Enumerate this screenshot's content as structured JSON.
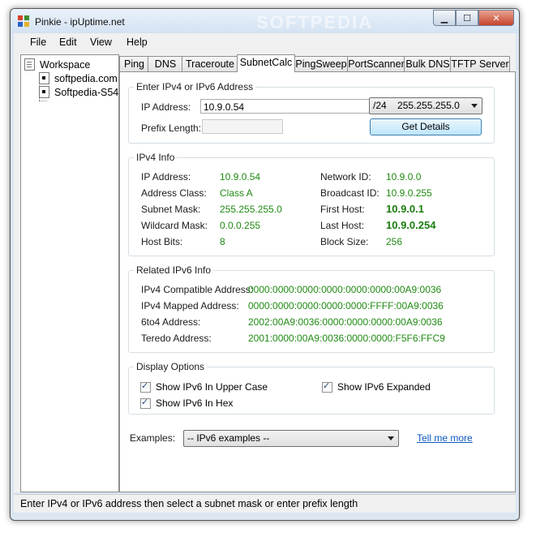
{
  "window": {
    "title": "Pinkie - ipUptime.net",
    "watermark": "SOFTPEDIA"
  },
  "menu": [
    "File",
    "Edit",
    "View",
    "Help"
  ],
  "tree": {
    "root": "Workspace",
    "children": [
      "softpedia.com",
      "Softpedia-S54"
    ]
  },
  "tabs": [
    "Ping",
    "DNS",
    "Traceroute",
    "SubnetCalc",
    "PingSweep",
    "PortScanner",
    "Bulk DNS",
    "TFTP Server"
  ],
  "active_tab": "SubnetCalc",
  "input_section": {
    "title": "Enter IPv4 or IPv6 Address",
    "ip_label": "IP Address:",
    "ip_value": "10.9.0.54",
    "prefix_label": "Prefix Length:",
    "prefix_value": "",
    "mask_select": "/24    255.255.255.0",
    "get_details": "Get Details"
  },
  "ipv4_info": {
    "title": "IPv4 Info",
    "left": [
      {
        "label": "IP Address:",
        "value": "10.9.0.54"
      },
      {
        "label": "Address Class:",
        "value": "Class A"
      },
      {
        "label": "Subnet Mask:",
        "value": "255.255.255.0"
      },
      {
        "label": "Wildcard Mask:",
        "value": "0.0.0.255"
      },
      {
        "label": "Host Bits:",
        "value": "8"
      }
    ],
    "right": [
      {
        "label": "Network ID:",
        "value": "10.9.0.0"
      },
      {
        "label": "Broadcast ID:",
        "value": "10.9.0.255"
      },
      {
        "label": "First Host:",
        "value": "10.9.0.1"
      },
      {
        "label": "Last Host:",
        "value": "10.9.0.254"
      },
      {
        "label": "Block Size:",
        "value": "256"
      }
    ]
  },
  "ipv6_info": {
    "title": "Related IPv6 Info",
    "rows": [
      {
        "label": "IPv4 Compatible Address:",
        "value": "0000:0000:0000:0000:0000:0000:00A9:0036"
      },
      {
        "label": "IPv4 Mapped Address:",
        "value": "0000:0000:0000:0000:0000:FFFF:00A9:0036"
      },
      {
        "label": "6to4 Address:",
        "value": "2002:00A9:0036:0000:0000:0000:00A9:0036"
      },
      {
        "label": "Teredo Address:",
        "value": "2001:0000:00A9:0036:0000:0000:F5F6:FFC9"
      }
    ]
  },
  "display_options": {
    "title": "Display Options",
    "upper_case": "Show IPv6 In Upper Case",
    "expanded": "Show IPv6 Expanded",
    "hex": "Show IPv6 In Hex"
  },
  "examples": {
    "label": "Examples:",
    "selected": "-- IPv6 examples --",
    "tell_me_more": "Tell me more"
  },
  "status": "Enter IPv4 or IPv6 address then select a subnet mask or enter prefix length",
  "colors": {
    "value_green": "#1f8a12",
    "link_blue": "#0a57c2",
    "titlebar": "#d4e2f2"
  }
}
